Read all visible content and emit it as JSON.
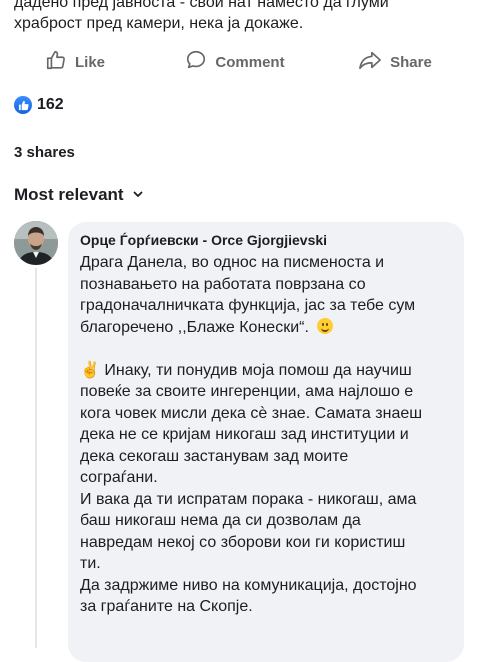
{
  "post": {
    "text_lines": [
      "дадено пред јавноста - свои нат наместо да глуми",
      "храброст пред камери, нека ја докаже."
    ]
  },
  "actions": {
    "like_label": "Like",
    "comment_label": "Comment",
    "share_label": "Share"
  },
  "reactions": {
    "count": "162"
  },
  "shares": {
    "label": "3 shares"
  },
  "comments_sort": {
    "label": "Most relevant"
  },
  "comment": {
    "author": "Орце Ѓорѓиевски - Orce Gjorgjievski",
    "lines": [
      "Драга Данела, во однос на писменоста и",
      "познавањето на работата поврзана со",
      "градоначалничката функција, јас за тебе сум",
      "благоречено ,,Блаже Конески“.",
      "",
      "✌️ Инаку, ти понудив моја помош да научиш",
      "повеќе за своите ингеренции, ама најлошо е",
      "кога човек мисли дека сѐ знае. Самата знаеш",
      "дека не се криjам никогаш зад институции и",
      "дека секогаш застанувам зад моите",
      "сограѓани.",
      "И вака да ти испратам порака - никогаш, ама",
      "баш никогаш нема да си дозволам да",
      "навредам некој со зборови кои ги користиш",
      "ти.",
      "Да задржиме ниво на комуникација, достојно",
      "за граѓаните на Скопје."
    ]
  },
  "colors": {
    "action_gray": "#65676b",
    "like_blue": "#1877f2",
    "bubble_bg": "#f0f2f5"
  },
  "icons": {
    "like": "thumbs-up-icon",
    "comment": "speech-bubble-icon",
    "share": "share-arrow-icon",
    "reaction": "like-reaction-icon",
    "sort": "chevron-down-icon",
    "emoji": "smile-emoji-icon"
  }
}
